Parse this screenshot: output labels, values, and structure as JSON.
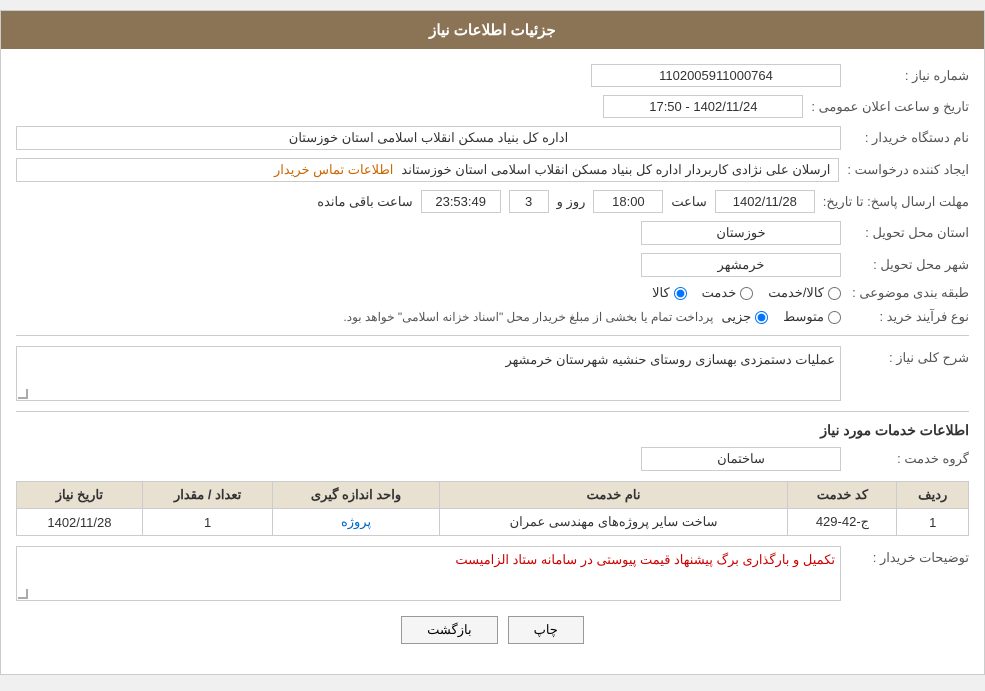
{
  "header": {
    "title": "جزئیات اطلاعات نیاز"
  },
  "fields": {
    "need_number_label": "شماره نیاز :",
    "need_number_value": "1102005911000764",
    "buyer_org_label": "نام دستگاه خریدار :",
    "buyer_org_value": "اداره کل بنیاد مسکن انقلاب اسلامی استان خوزستان",
    "creator_label": "ایجاد کننده درخواست :",
    "creator_value": "ارسلان علی نژادی کاربردار اداره کل بنیاد مسکن انقلاب اسلامی استان خوزستاند",
    "creator_contact_link": "اطلاعات تماس خریدار",
    "date_label": "تاریخ و ساعت اعلان عمومی :",
    "date_value": "1402/11/24 - 17:50",
    "response_deadline_label": "مهلت ارسال پاسخ: تا تاریخ:",
    "response_date": "1402/11/28",
    "response_time_label": "ساعت",
    "response_time_value": "18:00",
    "days_label": "روز و",
    "days_value": "3",
    "remaining_label": "ساعت باقی مانده",
    "remaining_value": "23:53:49",
    "province_label": "استان محل تحویل :",
    "province_value": "خوزستان",
    "city_label": "شهر محل تحویل :",
    "city_value": "خرمشهر",
    "category_label": "طبقه بندی موضوعی :",
    "category_options": [
      "کالا",
      "خدمت",
      "کالا/خدمت"
    ],
    "category_selected": "کالا",
    "purchase_type_label": "نوع فرآیند خرید :",
    "purchase_options": [
      "جزیی",
      "متوسط"
    ],
    "purchase_note": "پرداخت تمام یا بخشی از مبلغ خریدار محل \"اسناد خزانه اسلامی\" خواهد بود.",
    "need_description_label": "شرح کلی نیاز :",
    "need_description_value": "عملیات دستمزدی بهسازی روستای حنشیه  شهرستان خرمشهر",
    "services_title": "اطلاعات خدمات مورد نیاز",
    "service_group_label": "گروه خدمت :",
    "service_group_value": "ساختمان",
    "table": {
      "headers": [
        "ردیف",
        "کد خدمت",
        "نام خدمت",
        "واحد اندازه گیری",
        "تعداد / مقدار",
        "تاریخ نیاز"
      ],
      "rows": [
        {
          "row": "1",
          "code": "ج-42-429",
          "name": "ساخت سایر پروژه‌های مهندسی عمران",
          "unit": "پروژه",
          "quantity": "1",
          "date": "1402/11/28"
        }
      ]
    },
    "buyer_notes_label": "توضیحات خریدار :",
    "buyer_notes_value": "تکمیل و بارگذاری برگ پیشنهاد قیمت پیوستی در سامانه ستاد الزامیست",
    "btn_back": "بازگشت",
    "btn_print": "چاپ"
  }
}
